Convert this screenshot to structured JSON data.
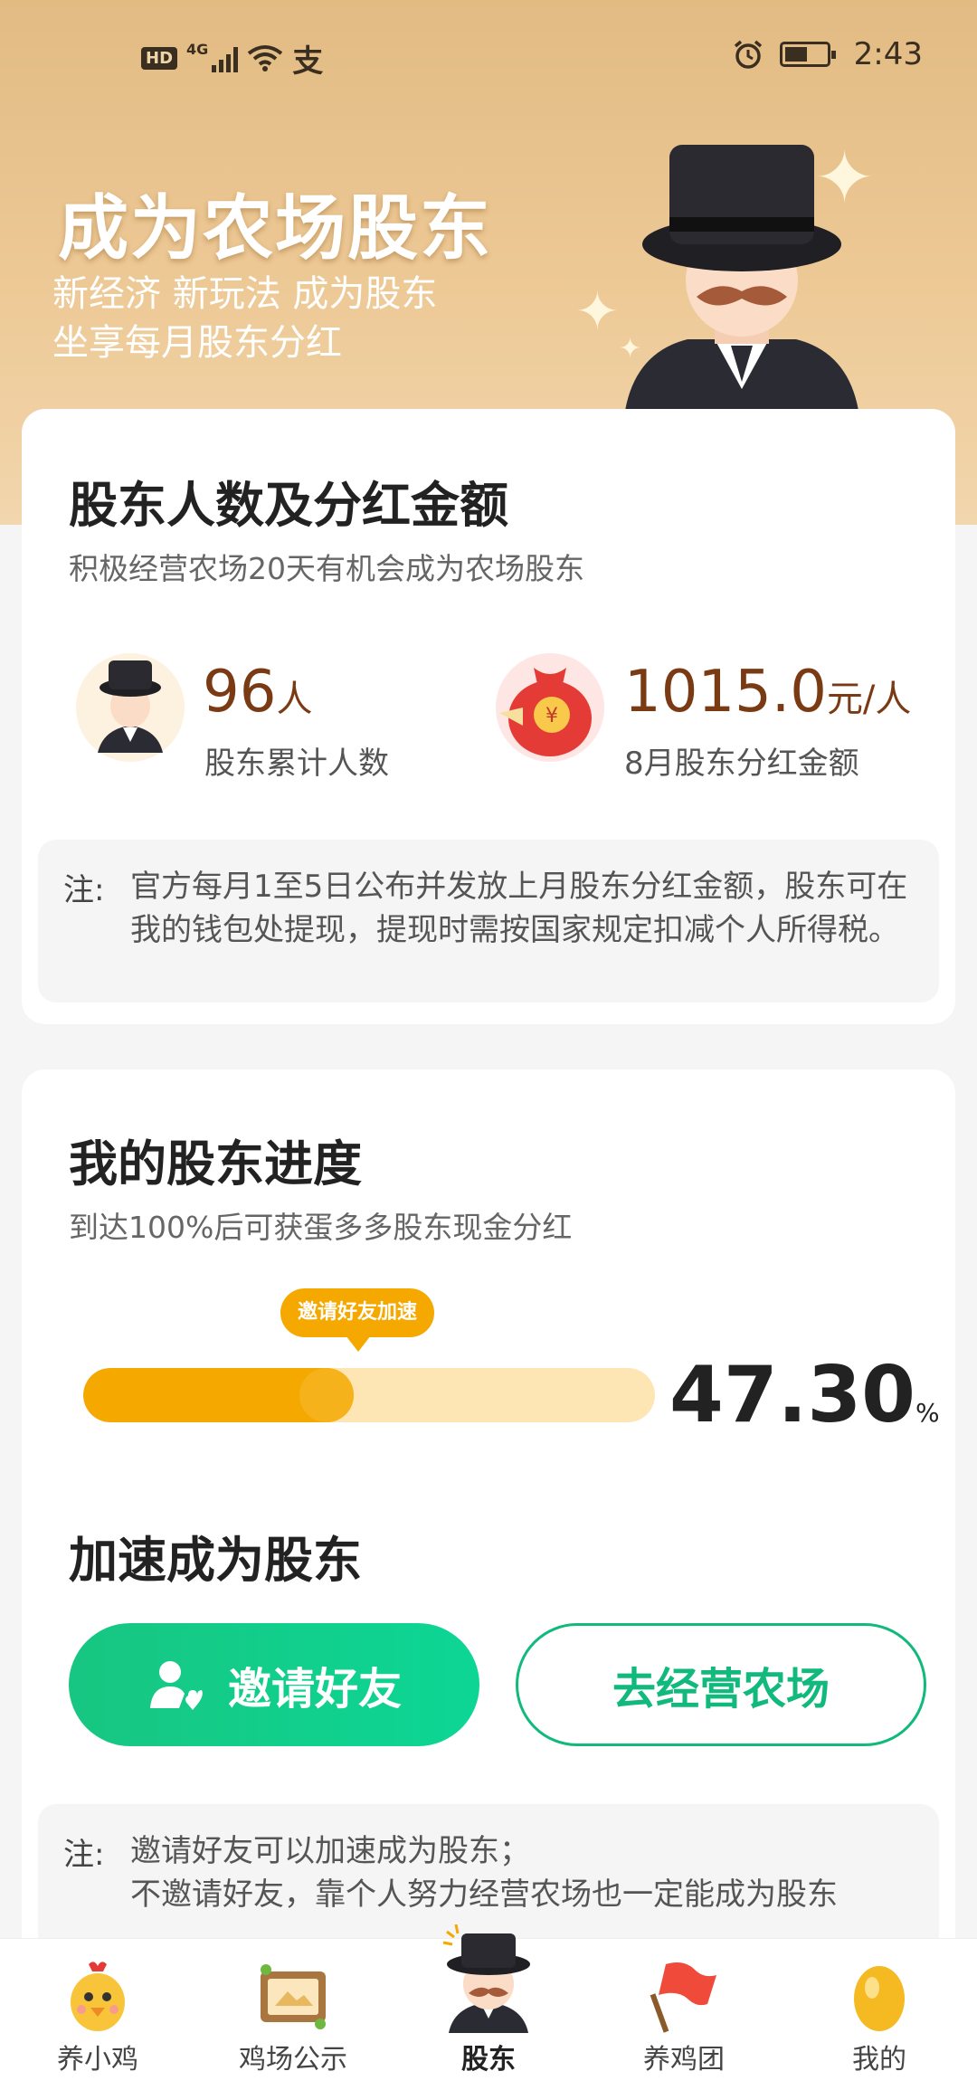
{
  "status_bar": {
    "network_badge": "HD",
    "network_type": "4G",
    "app_glyph": "支",
    "time": "2:43"
  },
  "hero": {
    "title": "成为农场股东",
    "subtitle_line1": "新经济 新玩法 成为股东",
    "subtitle_line2": "坐享每月股东分红"
  },
  "shareholders_card": {
    "title": "股东人数及分红金额",
    "subtitle": "积极经营农场20天有机会成为农场股东",
    "count_value": "96",
    "count_unit": "人",
    "count_label": "股东累计人数",
    "dividend_value": "1015.0",
    "dividend_unit": "元/人",
    "dividend_label": "8月股东分红金额",
    "note_label": "注:",
    "note_text": "官方每月1至5日公布并发放上月股东分红金额，股东可在我的钱包处提现，提现时需按国家规定扣减个人所得税。"
  },
  "progress_card": {
    "title": "我的股东进度",
    "subtitle": "到达100%后可获蛋多多股东现金分红",
    "bubble_label": "邀请好友加速",
    "progress_value": "47.30",
    "progress_unit": "%",
    "progress_fraction": 0.473,
    "accelerate_title": "加速成为股东",
    "invite_button": "邀请好友",
    "farm_button": "去经营农场",
    "note_label": "注:",
    "note_line1": "邀请好友可以加速成为股东；",
    "note_line2": "不邀请好友，靠个人努力经营农场也一定能成为股东"
  },
  "tabbar": {
    "items": [
      {
        "label": "养小鸡",
        "icon": "chick-icon"
      },
      {
        "label": "鸡场公示",
        "icon": "notice-board-icon"
      },
      {
        "label": "股东",
        "icon": "shareholder-icon"
      },
      {
        "label": "养鸡团",
        "icon": "flag-icon"
      },
      {
        "label": "我的",
        "icon": "golden-egg-icon"
      }
    ],
    "active_index": 2
  },
  "colors": {
    "hero_gold": "#e2bb83",
    "accent_orange": "#f5a900",
    "accent_green": "#12b97c",
    "value_brown": "#7a3b14"
  }
}
